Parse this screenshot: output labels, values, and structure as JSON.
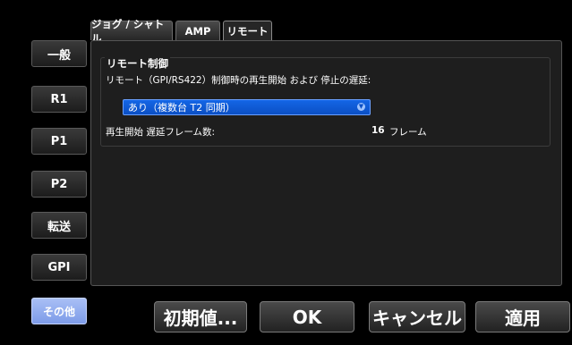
{
  "sidebar": {
    "items": [
      {
        "label": "一般"
      },
      {
        "label": "R1"
      },
      {
        "label": "P1"
      },
      {
        "label": "P2"
      },
      {
        "label": "転送"
      },
      {
        "label": "GPI"
      },
      {
        "label": "その他",
        "active": true
      }
    ]
  },
  "tabs": [
    {
      "label": "ジョグ / シャトル"
    },
    {
      "label": "AMP"
    },
    {
      "label": "リモート",
      "active": true
    }
  ],
  "remote": {
    "group_title": "リモート制御",
    "delay_description": "リモート（GPI/RS422）制御時の再生開始 および 停止の遅延:",
    "mode_selected": "あり（複数台 T2 同期）",
    "delay_frames_label": "再生開始 遅延フレーム数:",
    "delay_frames_value": "16",
    "delay_frames_unit": "フレーム"
  },
  "footer": {
    "defaults_label": "初期値...",
    "ok_label": "OK",
    "cancel_label": "キャンセル",
    "apply_label": "適用"
  },
  "colors": {
    "accent": "#0b4fc4",
    "active_side": "#8fa8ee",
    "background": "#000000"
  }
}
